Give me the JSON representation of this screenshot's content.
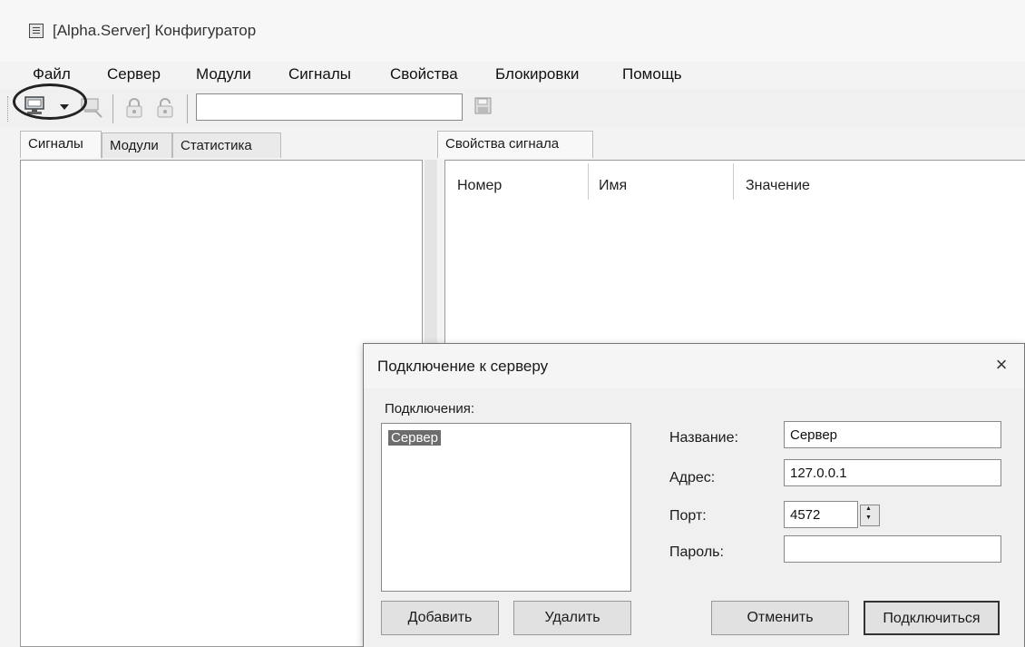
{
  "window": {
    "title": "[Alpha.Server] Конфигуратор"
  },
  "menu": [
    "Файл",
    "Сервер",
    "Модули",
    "Сигналы",
    "Свойства",
    "Блокировки",
    "Помощь"
  ],
  "toolbar": {
    "search_value": ""
  },
  "left_tabs": [
    "Сигналы",
    "Модули",
    "Статистика"
  ],
  "right_tabs": [
    "Свойства сигнала"
  ],
  "properties_table": {
    "columns": [
      "Номер",
      "Имя",
      "Значение"
    ]
  },
  "dialog": {
    "title": "Подключение к серверу",
    "close": "×",
    "connections_label": "Подключения:",
    "connections": [
      "Сервер"
    ],
    "fields": {
      "name_label": "Название:",
      "name_value": "Сервер",
      "address_label": "Адрес:",
      "address_value": "127.0.0.1",
      "port_label": "Порт:",
      "port_value": "4572",
      "password_label": "Пароль:",
      "password_value": ""
    },
    "buttons": {
      "add": "Добавить",
      "delete": "Удалить",
      "cancel": "Отменить",
      "connect": "Подключиться"
    }
  }
}
